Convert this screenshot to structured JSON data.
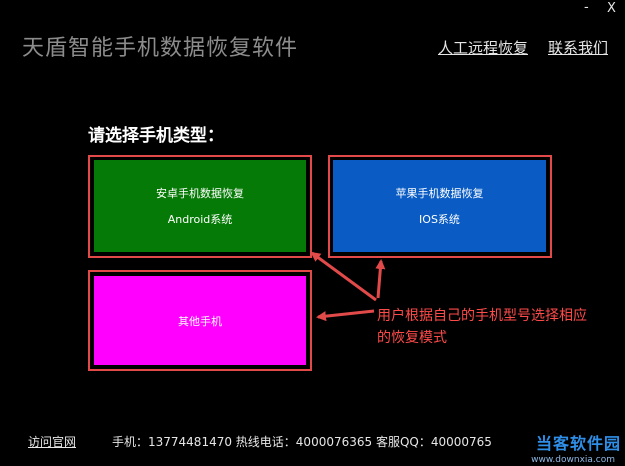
{
  "window": {
    "minimize_label": "-",
    "close_label": "X"
  },
  "header": {
    "title": "天盾智能手机数据恢复软件",
    "links": [
      "人工远程恢复",
      "联系我们"
    ]
  },
  "main": {
    "prompt": "请选择手机类型：",
    "tiles": [
      {
        "line1": "安卓手机数据恢复",
        "line2": "Android系统",
        "color": "#067a06"
      },
      {
        "line1": "苹果手机数据恢复",
        "line2": "IOS系统",
        "color": "#0a5cc4"
      },
      {
        "line1": "其他手机",
        "line2": "",
        "color": "#ff00ff"
      }
    ],
    "annotation_lines": [
      "用户根据自己的手机型号选择相应",
      "的恢复模式"
    ],
    "annotation_color": "#e24a4a"
  },
  "footer": {
    "visit_label": "访问官网",
    "info": "手机：13774481470 热线电话：4000076365 客服QQ：40000765"
  },
  "watermark": {
    "text": "当客软件园",
    "sub": "www.downxia.com"
  }
}
